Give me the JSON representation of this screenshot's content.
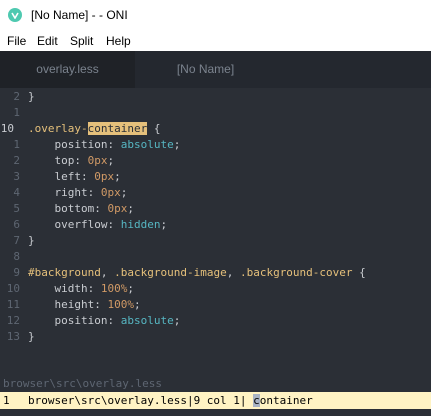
{
  "window": {
    "title": "[No Name] - - ONI"
  },
  "menu": [
    "File",
    "Edit",
    "Split",
    "Help"
  ],
  "tabs": [
    {
      "label": "overlay.less"
    },
    {
      "label": "[No Name]"
    }
  ],
  "colors": {
    "accent": "#e5c07b",
    "editor_bg": "#2b2f36",
    "tab_bg": "#24282f",
    "status_bg": "#fff3c4",
    "teal": "#4ec9b0"
  },
  "code": {
    "l0_num": "2",
    "l0": "}",
    "l1_num": "1",
    "l2_num": "10",
    "l2_sel_a": ".overlay-",
    "l2_sel_b": "container",
    "l2_brace": " {",
    "l3_num": "1",
    "l3_prop": "    position: ",
    "l3_val": "absolute",
    "l3_end": ";",
    "l4_num": "2",
    "l4_prop": "    top: ",
    "l4_val": "0px",
    "l4_end": ";",
    "l5_num": "3",
    "l5_prop": "    left: ",
    "l5_val": "0px",
    "l5_end": ";",
    "l6_num": "4",
    "l6_prop": "    right: ",
    "l6_val": "0px",
    "l6_end": ";",
    "l7_num": "5",
    "l7_prop": "    bottom: ",
    "l7_val": "0px",
    "l7_end": ";",
    "l8_num": "6",
    "l8_prop": "    overflow: ",
    "l8_val": "hidden",
    "l8_end": ";",
    "l9_num": "7",
    "l9": "}",
    "l10_num": "8",
    "l11_num": "9",
    "l11_a": "#background",
    "l11_b": ", ",
    "l11_c": ".background-image",
    "l11_d": ", ",
    "l11_e": ".background-cover",
    "l11_f": " {",
    "l12_num": "10",
    "l12_prop": "    width: ",
    "l12_val": "100%",
    "l12_end": ";",
    "l13_num": "11",
    "l13_prop": "    height: ",
    "l13_val": "100%",
    "l13_end": ";",
    "l14_num": "12",
    "l14_prop": "    position: ",
    "l14_val": "absolute",
    "l14_end": ";",
    "l15_num": "13",
    "l15": "}"
  },
  "footer": {
    "ghost_path": "browser\\src\\overlay.less",
    "status_line_num": "1",
    "status_path": "browser\\src\\overlay.less|9 col 1| ",
    "status_cursor": "c",
    "status_rest": "ontainer"
  }
}
